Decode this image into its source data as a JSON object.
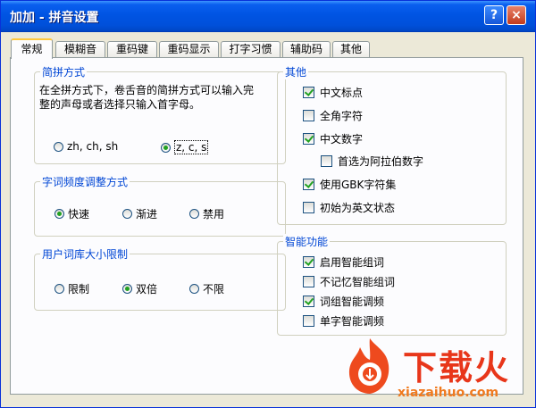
{
  "window": {
    "title": "加加 - 拼音设置",
    "help_button": "?",
    "close_button": "×"
  },
  "tabs": [
    {
      "label": "常规",
      "active": true
    },
    {
      "label": "模糊音"
    },
    {
      "label": "重码键"
    },
    {
      "label": "重码显示"
    },
    {
      "label": "打字习惯"
    },
    {
      "label": "辅助码"
    },
    {
      "label": "其他"
    }
  ],
  "jianpin": {
    "title": "简拼方式",
    "description": "在全拼方式下，卷舌音的简拼方式可以输入完整的声母或者选择只输入首字母。",
    "options": [
      {
        "label": "zh, ch, sh",
        "selected": false
      },
      {
        "label": "z, c, s",
        "selected": true
      }
    ]
  },
  "frequency": {
    "title": "字词频度调整方式",
    "options": [
      {
        "label": "快速",
        "selected": true
      },
      {
        "label": "渐进",
        "selected": false
      },
      {
        "label": "禁用",
        "selected": false
      }
    ]
  },
  "dict_limit": {
    "title": "用户词库大小限制",
    "options": [
      {
        "label": "限制",
        "selected": false
      },
      {
        "label": "双倍",
        "selected": true
      },
      {
        "label": "不限",
        "selected": false
      }
    ]
  },
  "other": {
    "title": "其他",
    "items": [
      {
        "label": "中文标点",
        "checked": true
      },
      {
        "label": "全角字符",
        "checked": false
      },
      {
        "label": "中文数字",
        "checked": true
      },
      {
        "label": "首选为阿拉伯数字",
        "checked": false
      },
      {
        "label": "使用GBK字符集",
        "checked": true
      },
      {
        "label": "初始为英文状态",
        "checked": false
      }
    ]
  },
  "smart": {
    "title": "智能功能",
    "items": [
      {
        "label": "启用智能组词",
        "checked": true
      },
      {
        "label": "不记忆智能组词",
        "checked": false
      },
      {
        "label": "词组智能调频",
        "checked": true
      },
      {
        "label": "单字智能调频",
        "checked": false
      }
    ]
  },
  "watermark": {
    "brand": "下载火",
    "url": "xiazaihuo.com"
  },
  "colors": {
    "title_bar": "#0054E3",
    "group_title": "#0046D5",
    "check_mark": "#21A121",
    "dialog_bg": "#ECE9D8",
    "watermark": "#E8361A"
  }
}
